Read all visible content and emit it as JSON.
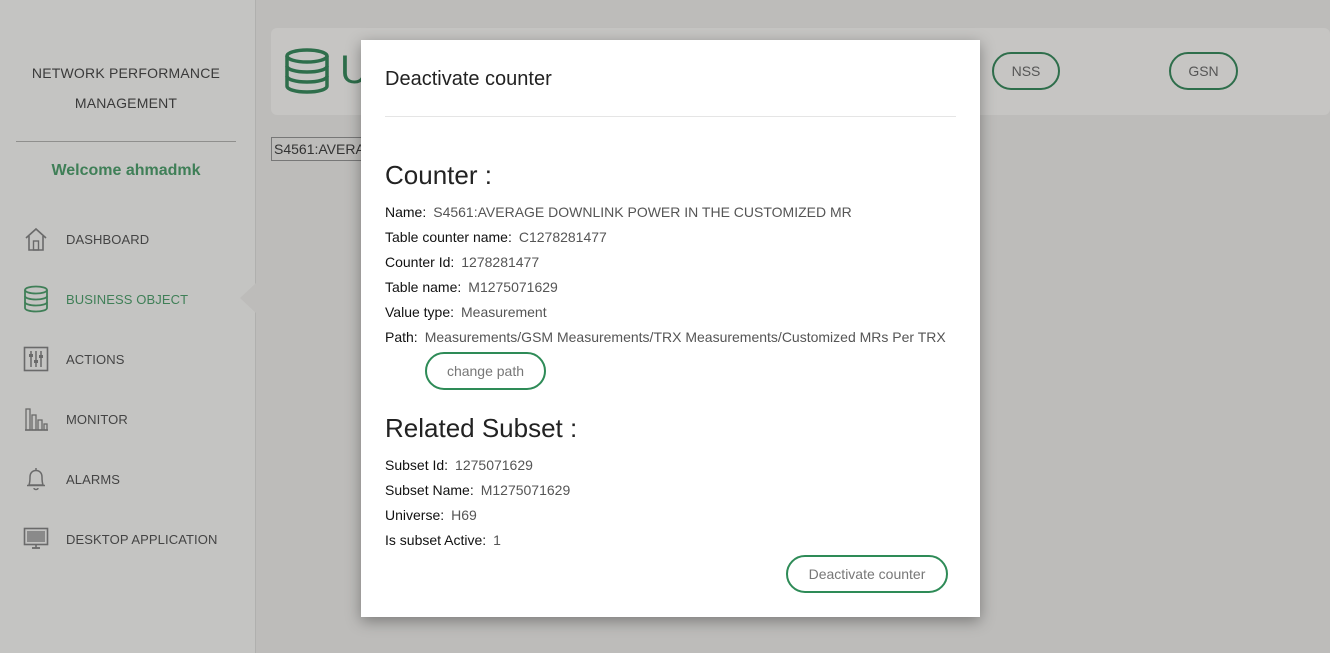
{
  "sidebar": {
    "title": "NETWORK PERFORMANCE MANAGEMENT",
    "welcome": "Welcome ahmadmk",
    "items": [
      {
        "label": "DASHBOARD",
        "icon": "home-icon"
      },
      {
        "label": "BUSINESS OBJECT",
        "icon": "database-icon",
        "active": true
      },
      {
        "label": "ACTIONS",
        "icon": "sliders-icon"
      },
      {
        "label": "MONITOR",
        "icon": "bar-chart-icon"
      },
      {
        "label": "ALARMS",
        "icon": "bell-icon"
      },
      {
        "label": "DESKTOP APPLICATION",
        "icon": "monitor-icon"
      }
    ]
  },
  "header": {
    "letter": "U",
    "buttons": [
      "NSS",
      "GSN"
    ]
  },
  "background_input": {
    "value": "S4561:AVERA"
  },
  "modal": {
    "title": "Deactivate counter",
    "counter_section": "Counter :",
    "counter_fields": [
      {
        "label": "Name:",
        "value": "S4561:AVERAGE DOWNLINK POWER IN THE CUSTOMIZED MR"
      },
      {
        "label": "Table counter name:",
        "value": "C1278281477"
      },
      {
        "label": "Counter Id:",
        "value": "1278281477"
      },
      {
        "label": "Table name:",
        "value": "M1275071629"
      },
      {
        "label": "Value type:",
        "value": "Measurement"
      },
      {
        "label": "Path:",
        "value": "Measurements/GSM Measurements/TRX Measurements/Customized MRs Per TRX"
      }
    ],
    "change_path_label": "change path",
    "subset_section": "Related Subset :",
    "subset_fields": [
      {
        "label": "Subset Id:",
        "value": "1275071629"
      },
      {
        "label": "Subset Name:",
        "value": "M1275071629"
      },
      {
        "label": "Universe:",
        "value": "H69"
      },
      {
        "label": "Is subset Active:",
        "value": "1"
      }
    ],
    "deactivate_label": "Deactivate counter"
  },
  "colors": {
    "accent": "#2e8b57",
    "welcome": "#3f7f57",
    "overlay_bg": "#bdbcba"
  }
}
